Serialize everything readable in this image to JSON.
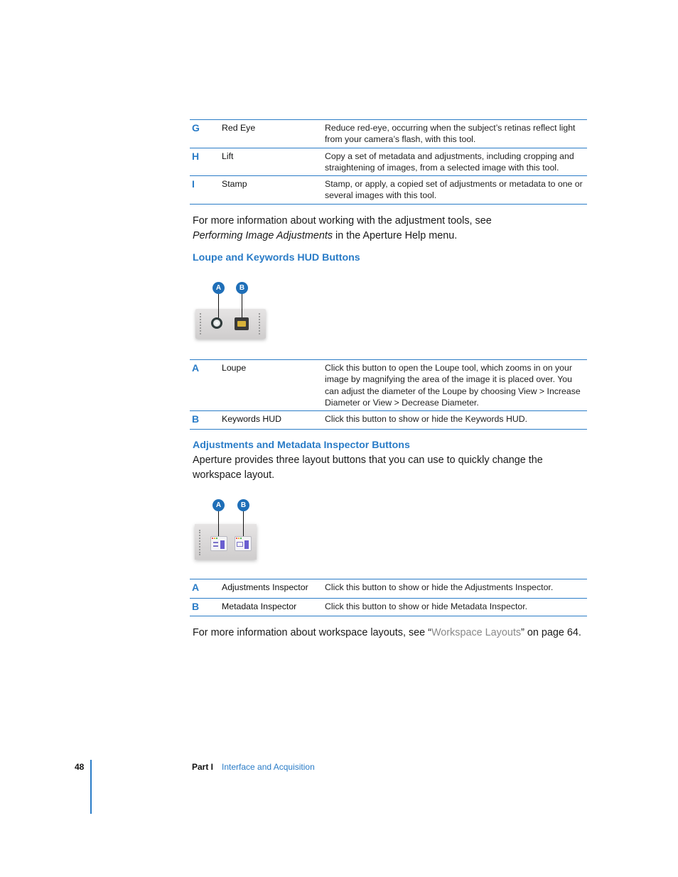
{
  "tool_table": {
    "rows": [
      {
        "letter": "G",
        "name": "Red Eye",
        "desc": "Reduce red-eye, occurring when the subject’s retinas reflect light from your camera’s flash, with this tool."
      },
      {
        "letter": "H",
        "name": "Lift",
        "desc": "Copy a set of metadata and adjustments, including cropping and straightening of images, from a selected image with this tool."
      },
      {
        "letter": "I",
        "name": "Stamp",
        "desc": "Stamp, or apply, a copied set of adjustments or metadata to one or several images with this tool."
      }
    ]
  },
  "para1": {
    "line1": "For more information about working with the adjustment tools, see",
    "italic": "Performing Image Adjustments",
    "line2_rest": " in the Aperture Help menu."
  },
  "section1": {
    "heading": "Loupe and Keywords HUD Buttons",
    "callouts": [
      "A",
      "B"
    ],
    "table": [
      {
        "letter": "A",
        "name": "Loupe",
        "desc": "Click this button to open the Loupe tool, which zooms in on your image by magnifying the area of the image it is placed over. You can adjust the diameter of the Loupe by choosing View > Increase Diameter or View > Decrease Diameter."
      },
      {
        "letter": "B",
        "name": "Keywords HUD",
        "desc": "Click this button to show or hide the Keywords HUD."
      }
    ]
  },
  "section2": {
    "heading": "Adjustments and Metadata Inspector Buttons",
    "intro": "Aperture provides three layout buttons that you can use to quickly change the workspace layout.",
    "callouts": [
      "A",
      "B"
    ],
    "table": [
      {
        "letter": "A",
        "name": "Adjustments Inspector",
        "desc": "Click this button to show or hide the Adjustments Inspector."
      },
      {
        "letter": "B",
        "name": "Metadata Inspector",
        "desc": "Click this button to show or hide Metadata Inspector."
      }
    ]
  },
  "para_final": {
    "before": "For more information about workspace layouts, see “",
    "link": "Workspace Layouts",
    "after": "” on page 64."
  },
  "footer": {
    "page_number": "48",
    "part": "Part I",
    "chapter": "Interface and Acquisition"
  }
}
